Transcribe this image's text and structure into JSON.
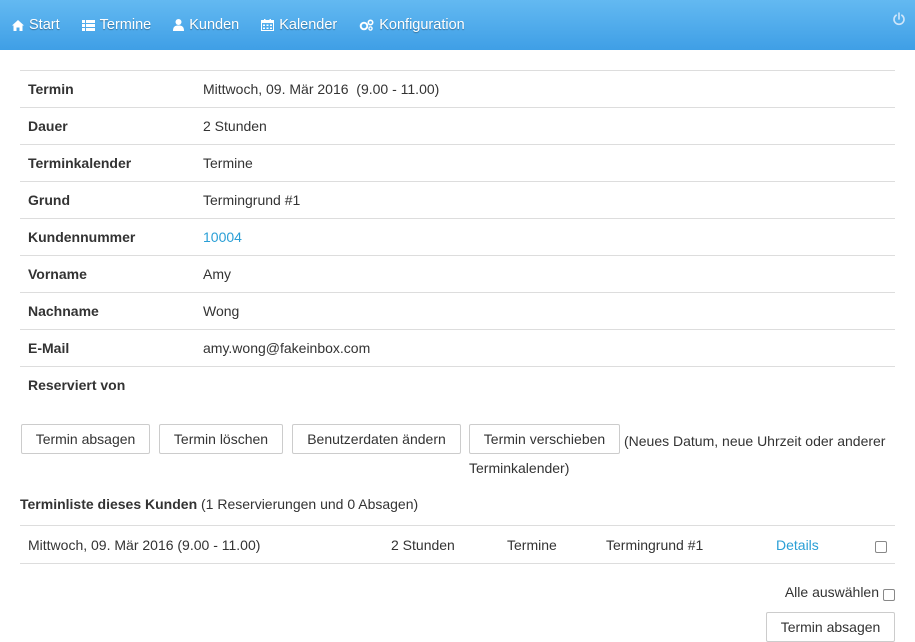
{
  "nav": {
    "items": [
      {
        "id": "start",
        "label": "Start",
        "icon": "home-icon"
      },
      {
        "id": "termine",
        "label": "Termine",
        "icon": "list-icon"
      },
      {
        "id": "kunden",
        "label": "Kunden",
        "icon": "user-icon"
      },
      {
        "id": "kalender",
        "label": "Kalender",
        "icon": "calendar-icon"
      },
      {
        "id": "konfiguration",
        "label": "Konfiguration",
        "icon": "gears-icon"
      }
    ],
    "logout_icon": "power-icon"
  },
  "details": {
    "rows": [
      {
        "label": "Termin",
        "value": "Mittwoch, 09. Mär 2016  (9.00 - 11.00)"
      },
      {
        "label": "Dauer",
        "value": "2 Stunden"
      },
      {
        "label": "Terminkalender",
        "value": "Termine"
      },
      {
        "label": "Grund",
        "value": "Termingrund #1"
      },
      {
        "label": "Kundennummer",
        "value": "10004"
      },
      {
        "label": "Vorname",
        "value": "Amy"
      },
      {
        "label": "Nachname",
        "value": "Wong"
      },
      {
        "label": "E-Mail",
        "value": "amy.wong@fakeinbox.com"
      },
      {
        "label": "Reserviert von",
        "value": ""
      }
    ]
  },
  "actions": {
    "cancel": "Termin absagen",
    "delete": "Termin löschen",
    "edit_user": "Benutzerdaten ändern",
    "reschedule": "Termin verschieben",
    "reschedule_note_line1": "(Neues Datum, neue Uhrzeit oder anderer",
    "reschedule_note_line2": "Terminkalender)"
  },
  "list": {
    "title": "Terminliste dieses Kunden",
    "summary": "(1 Reservierungen und 0 Absagen)",
    "rows": [
      {
        "date": "Mittwoch, 09. Mär 2016 (9.00 - 11.00)",
        "duration": "2 Stunden",
        "calendar": "Termine",
        "reason": "Termingrund #1",
        "details": "Details"
      }
    ],
    "select_all": "Alle auswählen",
    "cancel_button": "Termin absagen"
  },
  "colors": {
    "nav_top": "#63b9f1",
    "nav_bottom": "#3f9fe6",
    "link": "#2a9fd6",
    "border": "#dddddd"
  }
}
